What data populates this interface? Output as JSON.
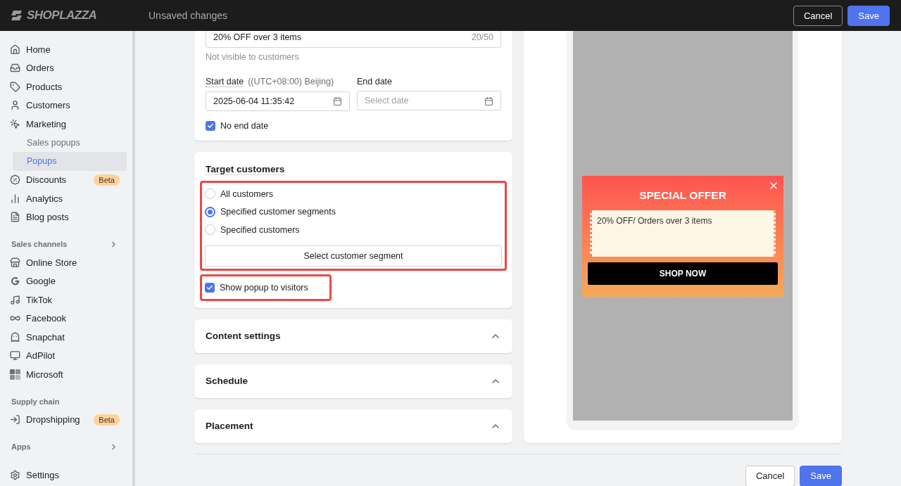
{
  "topbar": {
    "logo": "SHOPLAZZA",
    "title": "Unsaved changes",
    "buttons": [
      {
        "label": "Cancel",
        "kind": "secondary"
      },
      {
        "label": "Save",
        "kind": "primary"
      }
    ]
  },
  "sidebar": {
    "sections": [
      {
        "items": [
          {
            "label": "Home",
            "selected": false
          },
          {
            "label": "Orders",
            "selected": false
          },
          {
            "label": "Products",
            "selected": false
          },
          {
            "label": "Customers",
            "selected": false
          },
          {
            "label": "Marketing",
            "selected": false,
            "children": [
              {
                "label": "Sales popups",
                "selected": false
              },
              {
                "label": "Popups",
                "selected": true
              }
            ]
          },
          {
            "label": "Discounts",
            "selected": false,
            "badge": "Beta"
          },
          {
            "label": "Analytics",
            "selected": false
          },
          {
            "label": "Blog posts",
            "selected": false
          }
        ]
      },
      {
        "heading": "Sales channels",
        "expandable": true,
        "items": [
          {
            "label": "Online Store",
            "selected": false
          },
          {
            "label": "Google",
            "selected": false
          },
          {
            "label": "TikTok",
            "selected": false
          },
          {
            "label": "Facebook",
            "selected": false
          },
          {
            "label": "Snapchat",
            "selected": false
          },
          {
            "label": "AdPilot",
            "selected": false
          },
          {
            "label": "Microsoft",
            "selected": false
          }
        ]
      },
      {
        "heading": "Supply chain",
        "expandable": false,
        "items": [
          {
            "label": "Dropshipping",
            "selected": false,
            "badge": "Beta"
          }
        ]
      },
      {
        "heading": "Apps",
        "expandable": true
      }
    ],
    "footer_items": [
      {
        "label": "Settings",
        "selected": false
      }
    ]
  },
  "form": {
    "name_field": {
      "value": "20% OFF over 3 items",
      "counter": "20/50",
      "help": "Not visible to customers"
    },
    "start_date": {
      "label": "Start date",
      "timezone": "((UTC+08:00) Beijing)",
      "value": "2025-06-04 11:35:42"
    },
    "end_date": {
      "label": "End date",
      "placeholder": "Select date"
    },
    "no_end_date": {
      "label": "No end date",
      "checked": true
    }
  },
  "target": {
    "title": "Target customers",
    "options": [
      {
        "label": "All customers",
        "selected": false
      },
      {
        "label": "Specified customer segments",
        "selected": true
      },
      {
        "label": "Specified customers",
        "selected": false
      }
    ],
    "segment_button": "Select customer segment",
    "show_to_visitors": {
      "label": "Show popup to visitors",
      "checked": true
    }
  },
  "sections": [
    {
      "title": "Content settings",
      "expanded": false
    },
    {
      "title": "Schedule",
      "expanded": false
    },
    {
      "title": "Placement",
      "expanded": false
    }
  ],
  "preview": {
    "title": "SPECIAL OFFER",
    "coupon_text": "20% OFF/ Orders over 3 items",
    "button": "SHOP NOW"
  },
  "footer_buttons": [
    {
      "label": "Cancel",
      "kind": "secondary"
    },
    {
      "label": "Save",
      "kind": "primary"
    }
  ]
}
